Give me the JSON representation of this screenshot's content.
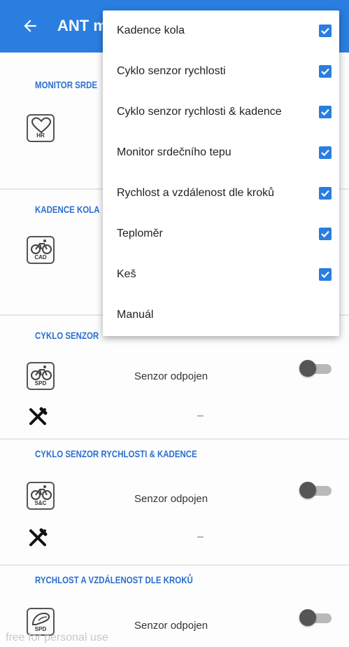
{
  "appbar": {
    "title": "ANT m",
    "back_icon": "arrow-left-icon",
    "background": "#2a7ee0"
  },
  "sections": [
    {
      "title": "MONITOR SRDE",
      "icon": "heart-rate-icon",
      "icon_tag": "HR"
    },
    {
      "title": "KADENCE KOLA",
      "icon": "bike-cadence-icon",
      "icon_tag": "CAD"
    },
    {
      "title": "CYKLO SENZOR",
      "icon": "bike-speed-icon",
      "icon_tag": "SPD",
      "status": "Senzor odpojen",
      "value": "–"
    },
    {
      "title": "CYKLO SENZOR RYCHLOSTI & KADENCE",
      "icon": "bike-speed-cadence-icon",
      "icon_tag": "S&C",
      "status": "Senzor odpojen",
      "value": "–"
    },
    {
      "title": "RYCHLOST A VZDÁLENOST DLE KROKŮ",
      "icon": "shoe-pod-icon",
      "icon_tag": "SPD",
      "status": "Senzor odpojen"
    }
  ],
  "menu": {
    "items": [
      {
        "label": "Kadence kola",
        "checked": true
      },
      {
        "label": "Cyklo senzor rychlosti",
        "checked": true
      },
      {
        "label": "Cyklo senzor rychlosti & kadence",
        "checked": true
      },
      {
        "label": "Monitor srdečního tepu",
        "checked": true
      },
      {
        "label": "Rychlost a vzdálenost dle kroků",
        "checked": true
      },
      {
        "label": "Teploměr",
        "checked": true
      },
      {
        "label": "Keš",
        "checked": true
      },
      {
        "label": "Manuál",
        "checked": false
      }
    ],
    "accent": "#2a7ee0"
  },
  "watermark": "free for personal use"
}
